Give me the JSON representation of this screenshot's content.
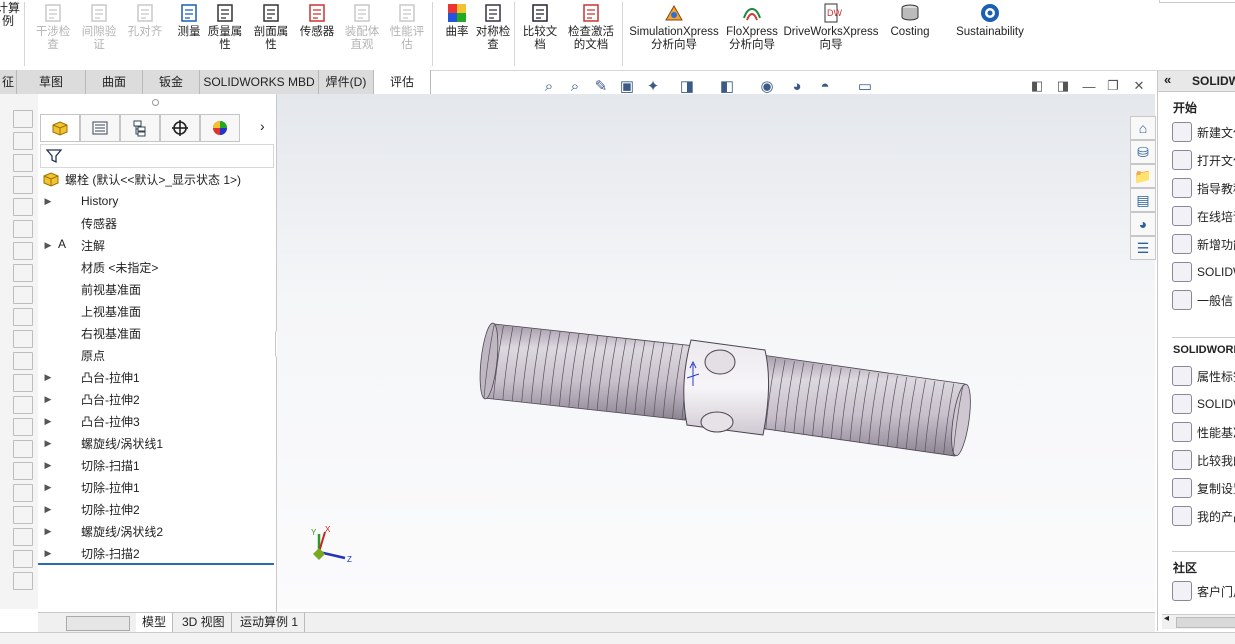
{
  "ribbon": {
    "left_cut_label": "计算\n例",
    "buttons": [
      {
        "label": "干涉检\n查",
        "disabled": true
      },
      {
        "label": "间隙验\n证",
        "disabled": true
      },
      {
        "label": "孔对齐",
        "disabled": true
      },
      {
        "label": "测量",
        "disabled": false
      },
      {
        "label": "质量属\n性",
        "disabled": false
      },
      {
        "label": "剖面属\n性",
        "disabled": false
      },
      {
        "label": "传感器",
        "disabled": false
      },
      {
        "label": "装配体\n直观",
        "disabled": true
      },
      {
        "label": "性能评\n估",
        "disabled": true
      },
      {
        "label": "曲率",
        "disabled": false
      },
      {
        "label": "对称检\n查",
        "disabled": false
      },
      {
        "label": "比较文\n档",
        "disabled": false
      },
      {
        "label": "检查激活\n的文档",
        "disabled": false
      },
      {
        "label": "SimulationXpress\n分析向导",
        "disabled": false
      },
      {
        "label": "FloXpress\n分析向导",
        "disabled": false
      },
      {
        "label": "DriveWorksXpress\n向导",
        "disabled": false
      },
      {
        "label": "Costing",
        "disabled": false
      },
      {
        "label": "Sustainability",
        "disabled": false
      }
    ]
  },
  "tabs": [
    "征",
    "草图",
    "曲面",
    "钣金",
    "SOLIDWORKS MBD",
    "焊件(D)",
    "评估"
  ],
  "active_tab": "评估",
  "feature_tree": {
    "root": "螺栓  (默认<<默认>_显示状态 1>)",
    "items": [
      {
        "label": "History",
        "expandable": true,
        "icon": "history-folder-icon"
      },
      {
        "label": "传感器",
        "expandable": false,
        "icon": "sensor-icon"
      },
      {
        "label": "注解",
        "expandable": true,
        "icon": "annotation-icon"
      },
      {
        "label": "材质 <未指定>",
        "expandable": false,
        "icon": "material-icon"
      },
      {
        "label": "前视基准面",
        "expandable": false,
        "icon": "plane-icon"
      },
      {
        "label": "上视基准面",
        "expandable": false,
        "icon": "plane-icon"
      },
      {
        "label": "右视基准面",
        "expandable": false,
        "icon": "plane-icon"
      },
      {
        "label": "原点",
        "expandable": false,
        "icon": "origin-icon"
      },
      {
        "label": "凸台-拉伸1",
        "expandable": true,
        "icon": "boss-extrude-icon"
      },
      {
        "label": "凸台-拉伸2",
        "expandable": true,
        "icon": "boss-extrude-icon"
      },
      {
        "label": "凸台-拉伸3",
        "expandable": true,
        "icon": "boss-extrude-icon"
      },
      {
        "label": "螺旋线/涡状线1",
        "expandable": true,
        "icon": "helix-icon"
      },
      {
        "label": "切除-扫描1",
        "expandable": true,
        "icon": "cut-sweep-icon"
      },
      {
        "label": "切除-拉伸1",
        "expandable": true,
        "icon": "cut-extrude-icon"
      },
      {
        "label": "切除-拉伸2",
        "expandable": true,
        "icon": "cut-extrude-icon"
      },
      {
        "label": "螺旋线/涡状线2",
        "expandable": true,
        "icon": "helix-icon"
      },
      {
        "label": "切除-扫描2",
        "expandable": true,
        "icon": "cut-sweep-icon"
      }
    ]
  },
  "task_pane": {
    "header": "SOLIDW",
    "section1": "开始",
    "section1_items": [
      "新建文件",
      "打开文件",
      "指导教程",
      "在线培训",
      "新增功能",
      "SOLIDW",
      "一般信"
    ],
    "section2": "SOLIDWORK",
    "section2_items": [
      "属性标签",
      "SOLIDW",
      "性能基准",
      "比较我的",
      "复制设置",
      "我的产品"
    ],
    "section3": "社区",
    "section3_items": [
      "客户门户"
    ]
  },
  "bottom_tabs": [
    "模型",
    "3D 视图",
    "运动算例 1"
  ],
  "triad": {
    "x": "X",
    "y": "Y",
    "z": "Z"
  },
  "colors": {
    "accent": "#2b6cb0",
    "model": "#c9c2cc"
  }
}
